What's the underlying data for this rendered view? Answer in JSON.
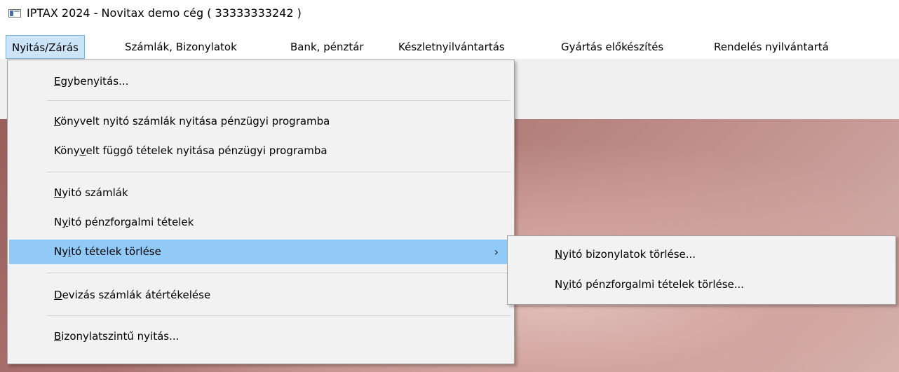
{
  "window": {
    "title": "IPTAX 2024 - Novitax demo cég ( 33333333242 )"
  },
  "menubar": {
    "items": [
      {
        "label": "Nyitás/Zárás"
      },
      {
        "label": "Számlák, Bizonylatok"
      },
      {
        "label": "Bank, pénztár"
      },
      {
        "label": "Készletnyilvántartás"
      },
      {
        "label": "Gyártás előkészítés"
      },
      {
        "label": "Rendelés nyilvántartá"
      }
    ]
  },
  "dropdown": {
    "items": [
      {
        "pre": "",
        "key": "E",
        "post": "gybenyitás..."
      },
      {
        "pre": "",
        "key": "K",
        "post": "önyvelt nyitó számlák nyitása pénzügyi programba"
      },
      {
        "pre": "Köny",
        "key": "v",
        "post": "elt függő tételek nyitása pénzügyi programba"
      },
      {
        "pre": "",
        "key": "N",
        "post": "yitó számlák"
      },
      {
        "pre": "N",
        "key": "y",
        "post": "itó pénzforgalmi tételek"
      },
      {
        "pre": "Ny",
        "key": "i",
        "post": "tó tételek törlése",
        "submenu_arrow": "›"
      },
      {
        "pre": "",
        "key": "D",
        "post": "evizás számlák átértékelése"
      },
      {
        "pre": "",
        "key": "B",
        "post": "izonylatszintű nyitás..."
      }
    ]
  },
  "submenu": {
    "items": [
      {
        "pre": "",
        "key": "N",
        "post": "yitó bizonylatok törlése..."
      },
      {
        "pre": "N",
        "key": "y",
        "post": "itó pénzforgalmi tételek törlése..."
      }
    ]
  },
  "colors": {
    "highlight": "#91c9f7",
    "menu_background": "#f2f2f2",
    "active_menubar": "#cce4f7"
  }
}
